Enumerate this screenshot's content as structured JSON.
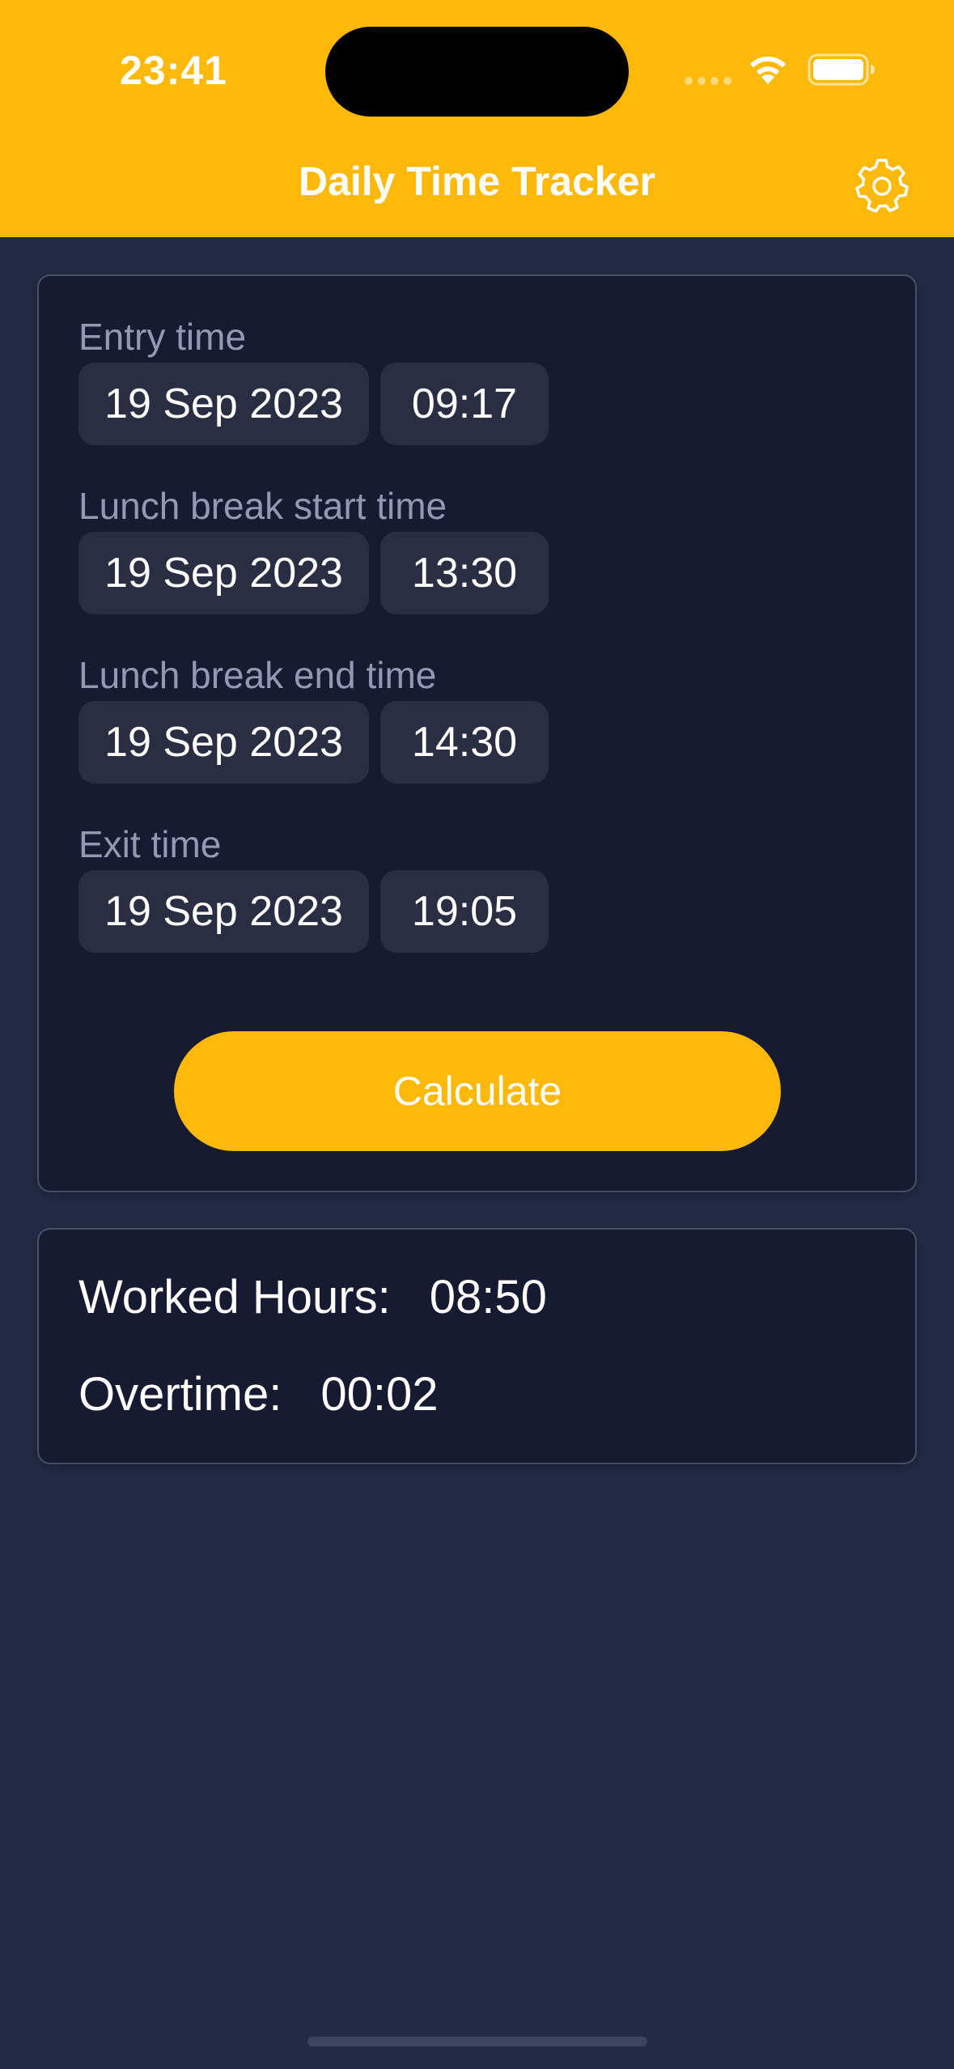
{
  "status_bar": {
    "time": "23:41"
  },
  "header": {
    "title": "Daily Time Tracker",
    "settings_icon": "gear-icon"
  },
  "fields": [
    {
      "label": "Entry time",
      "date": "19 Sep 2023",
      "time": "09:17"
    },
    {
      "label": "Lunch break start time",
      "date": "19 Sep 2023",
      "time": "13:30"
    },
    {
      "label": "Lunch break end time",
      "date": "19 Sep 2023",
      "time": "14:30"
    },
    {
      "label": "Exit time",
      "date": "19 Sep 2023",
      "time": "19:05"
    }
  ],
  "actions": {
    "calculate_label": "Calculate"
  },
  "results": {
    "worked_label": "Worked Hours:",
    "worked_value": "08:50",
    "overtime_label": "Overtime:",
    "overtime_value": "00:02"
  },
  "colors": {
    "accent": "#fdb90a",
    "background": "#232a45",
    "card": "#171b31",
    "chip": "#2a2e43",
    "label": "#9498b1"
  }
}
